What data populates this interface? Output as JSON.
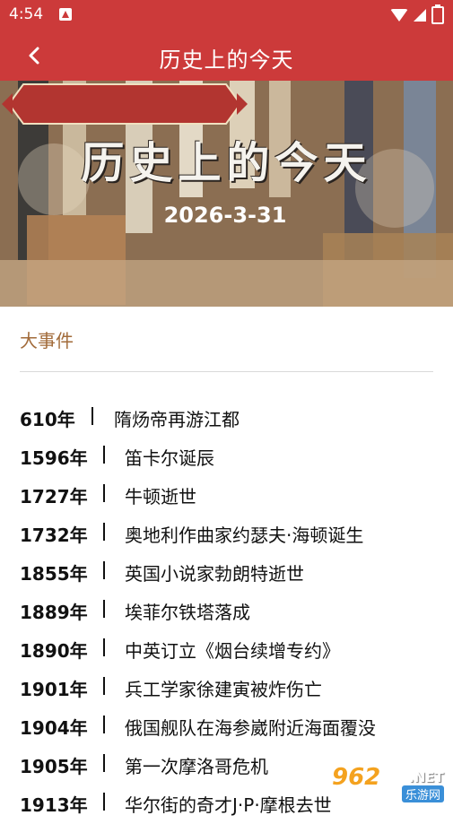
{
  "status_bar": {
    "time": "4:54"
  },
  "app_bar": {
    "title": "历史上的今天"
  },
  "banner": {
    "title": "历史上的今天",
    "date": "2026-3-31"
  },
  "section": {
    "heading": "大事件"
  },
  "events": [
    {
      "year": "610年",
      "desc": "隋炀帝再游江都"
    },
    {
      "year": "1596年",
      "desc": "笛卡尔诞辰"
    },
    {
      "year": "1727年",
      "desc": "牛顿逝世"
    },
    {
      "year": "1732年",
      "desc": "奥地利作曲家约瑟夫·海顿诞生"
    },
    {
      "year": "1855年",
      "desc": "英国小说家勃朗特逝世"
    },
    {
      "year": "1889年",
      "desc": "埃菲尔铁塔落成"
    },
    {
      "year": "1890年",
      "desc": "中英订立《烟台续增专约》"
    },
    {
      "year": "1901年",
      "desc": "兵工学家徐建寅被炸伤亡"
    },
    {
      "year": "1904年",
      "desc": "俄国舰队在海参崴附近海面覆没"
    },
    {
      "year": "1905年",
      "desc": "第一次摩洛哥危机"
    },
    {
      "year": "1913年",
      "desc": "华尔街的奇才J·P·摩根去世"
    }
  ],
  "watermark": {
    "number": "962",
    "net": ".NET",
    "sub": "乐游网"
  }
}
